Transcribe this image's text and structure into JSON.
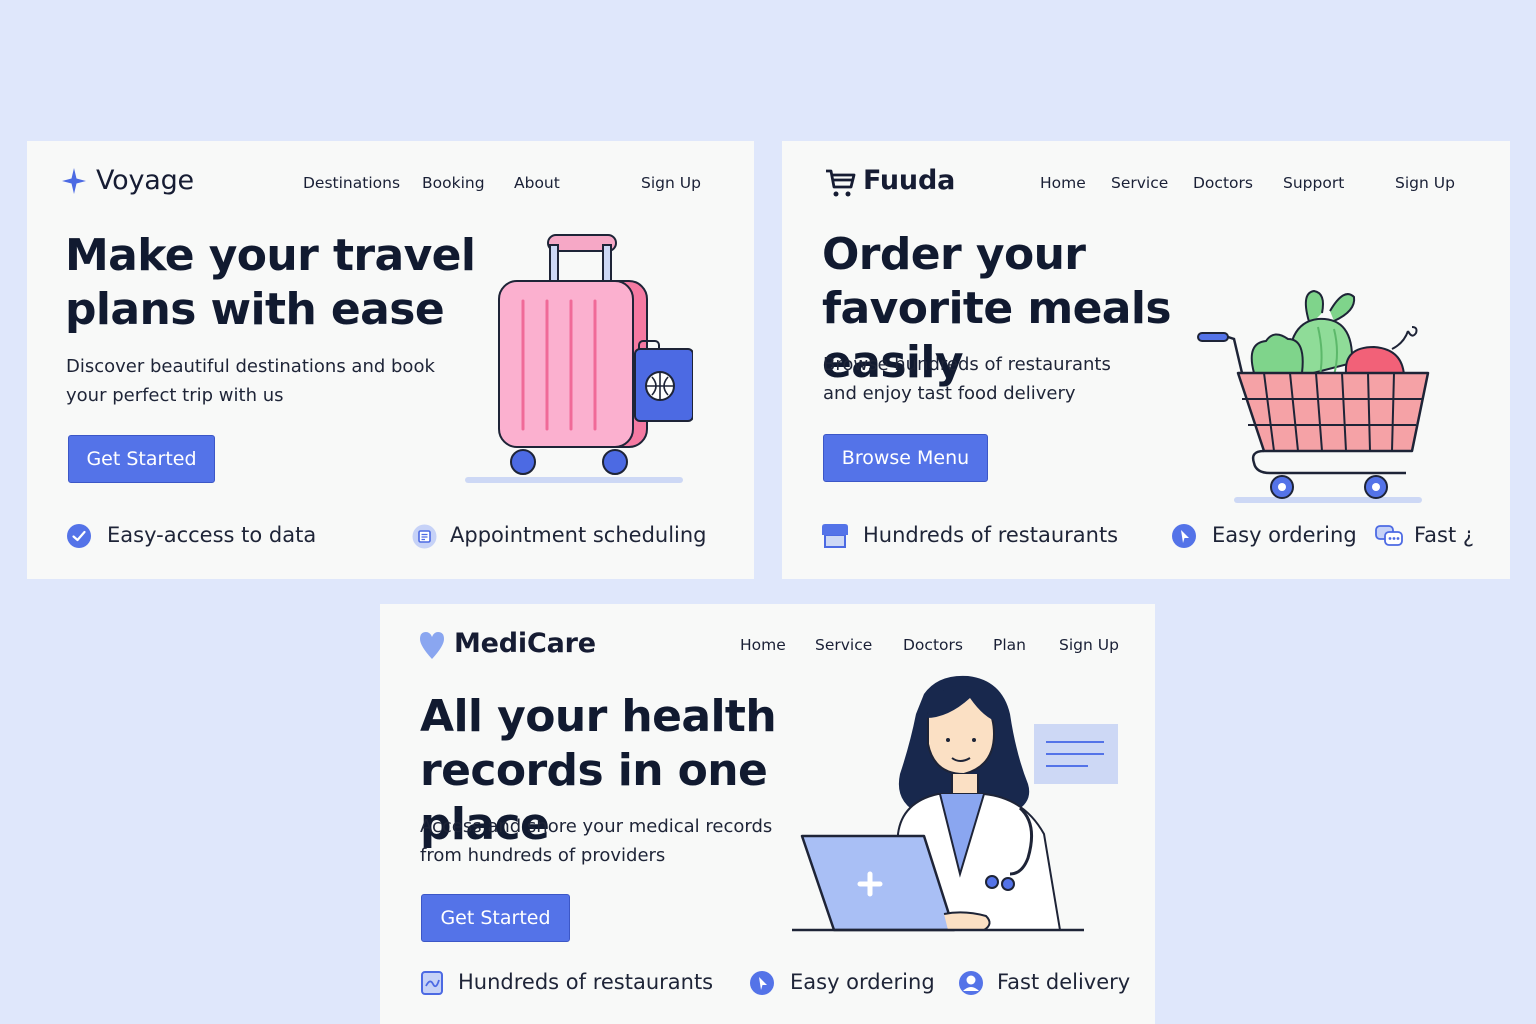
{
  "colors": {
    "background": "#dfe7fb",
    "card": "#f8f9f8",
    "accent": "#5473e8",
    "text": "#111a30"
  },
  "voyage": {
    "logo": {
      "name": "Voyage",
      "icon": "sparkle-icon"
    },
    "nav": [
      "Destinations",
      "Booking",
      "About",
      "Sign Up"
    ],
    "hero_title": "Make your travel plans with ease",
    "subtitle": "Discover beautiful destinations and book your perfect trip with us",
    "cta": "Get Started",
    "features": [
      {
        "icon": "check-circle-icon",
        "label": "Easy-access to data"
      },
      {
        "icon": "calendar-icon",
        "label": "Appointment scheduling"
      }
    ],
    "illustration": "suitcase-passport-illustration"
  },
  "fuuda": {
    "logo": {
      "name": "Fuuda",
      "icon": "cart-logo-icon"
    },
    "nav": [
      "Home",
      "Service",
      "Doctors",
      "Support",
      "Sign Up"
    ],
    "hero_title": "Order your favorite meals easily",
    "subtitle": "Browse hundreds of restaurants and enjoy tast food delivery",
    "cta": "Browse Menu",
    "features": [
      {
        "icon": "store-icon",
        "label": "Hundreds of restaurants"
      },
      {
        "icon": "pointer-icon",
        "label": "Easy ordering"
      },
      {
        "icon": "chat-icon",
        "label": "Fast ¿"
      }
    ],
    "illustration": "shopping-cart-groceries-illustration"
  },
  "medicare": {
    "logo": {
      "name": "MediCare",
      "icon": "heart-icon"
    },
    "nav": [
      "Home",
      "Service",
      "Doctors",
      "Plan",
      "Sign Up"
    ],
    "hero_title": "All your health records in one place",
    "subtitle": "Access and shore your medical records from hundreds of providers",
    "cta": "Get Started",
    "features": [
      {
        "icon": "document-icon",
        "label": "Hundreds of restaurants"
      },
      {
        "icon": "pointer-icon",
        "label": "Easy ordering"
      },
      {
        "icon": "user-icon",
        "label": "Fast delivery"
      }
    ],
    "illustration": "doctor-laptop-illustration"
  }
}
